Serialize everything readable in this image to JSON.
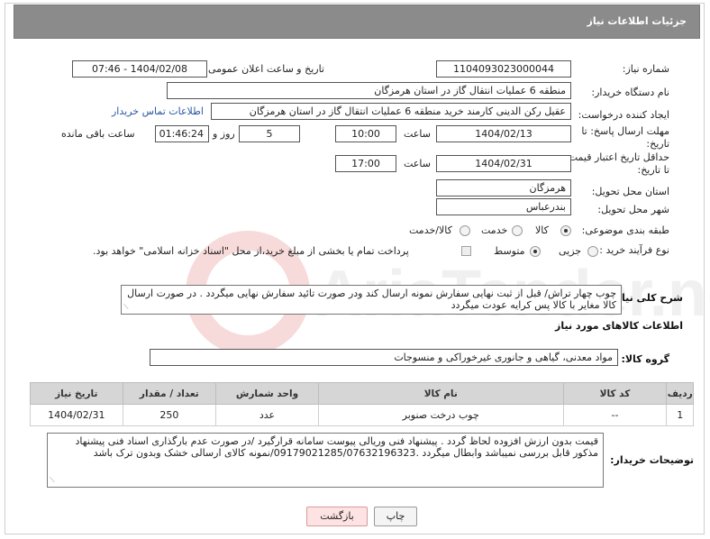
{
  "header": {
    "title": "جزئیات اطلاعات نیاز"
  },
  "fields": {
    "need_number_label": "شماره نیاز:",
    "need_number": "1104093023000044",
    "announce_label": "تاریخ و ساعت اعلان عمومی:",
    "announce_value": "1404/02/08 - 07:46",
    "buyer_org_label": "نام دستگاه خریدار:",
    "buyer_org": "منطقه 6 عملیات انتقال گاز در استان هرمزگان",
    "creator_label": "ایجاد کننده درخواست:",
    "creator": "عقیل رکن الدینی کارمند خرید منطقه 6 عملیات انتقال گاز در استان هرمزگان",
    "contact_link": "اطلاعات تماس خریدار",
    "deadline_label_1": "مهلت ارسال پاسخ: تا",
    "deadline_label_2": "تاریخ:",
    "deadline_date": "1404/02/13",
    "time_label": "ساعت",
    "deadline_time": "10:00",
    "days_value": "5",
    "days_label": "روز و",
    "remaining_time": "01:46:24",
    "remaining_label": "ساعت باقی مانده",
    "validity_label_1": "حداقل تاریخ اعتبار قیمت:",
    "validity_label_2": "تا تاریخ:",
    "validity_date": "1404/02/31",
    "validity_time": "17:00",
    "province_label": "استان محل تحویل:",
    "province": "هرمزگان",
    "city_label": "شهر محل تحویل:",
    "city": "بندرعباس",
    "category_label": "طبقه بندی موضوعی:",
    "category_options": [
      "کالا",
      "خدمت",
      "کالا/خدمت"
    ],
    "process_label": "نوع فرآیند خرید :",
    "process_options": [
      "جزیی",
      "متوسط"
    ],
    "payment_note": "پرداخت تمام یا بخشی از مبلغ خرید،از محل \"اسناد خزانه اسلامی\" خواهد بود."
  },
  "description": {
    "label": "شرح کلی نیاز:",
    "text": "چوب چهار تراش/ قبل از ثبت نهایی سفارش نمونه ارسال کند ودر صورت تائید سفارش نهایی میگردد . در صورت ارسال کالا مغایر با کالا پس کرایه عودت میگردد"
  },
  "goods_section": {
    "title": "اطلاعات کالاهای مورد نیاز",
    "group_label": "گروه کالا:",
    "group_value": "مواد معدنی، گیاهی و جانوری غیرخوراکی و منسوجات"
  },
  "table": {
    "headers": [
      "ردیف",
      "کد کالا",
      "نام کالا",
      "واحد شمارش",
      "تعداد / مقدار",
      "تاریخ نیاز"
    ],
    "rows": [
      [
        "1",
        "--",
        "چوب درخت صنوبر",
        "عدد",
        "250",
        "1404/02/31"
      ]
    ]
  },
  "buyer_notes": {
    "label": "توضیحات خریدار:",
    "text": "قیمت بدون ارزش افزوده لحاظ گردد . پیشنهاد فنی وریالی پیوست سامانه قرارگیرد /در صورت عدم بارگذاری اسناد فنی پیشنهاد مذکور قابل بررسی نمیباشد وابطال میگردد .09179021285/07632196323/نمونه کالای ارسالی خشک وبدون ترک باشد"
  },
  "buttons": {
    "print": "چاپ",
    "back": "بازگشت"
  },
  "watermark": "AriaTender.net",
  "colors": {
    "header_bg": "#8b8b8b",
    "link": "#2857a4",
    "back_bg": "#fde3e3"
  }
}
